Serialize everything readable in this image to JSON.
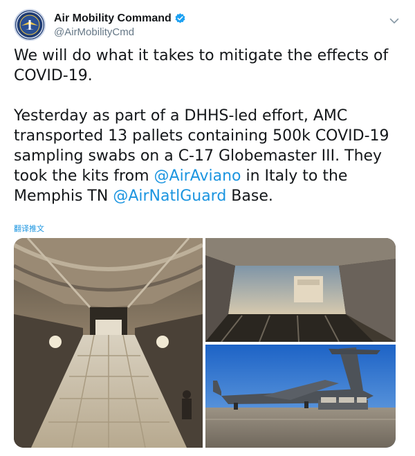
{
  "account": {
    "display_name": "Air Mobility Command",
    "handle": "@AirMobilityCmd",
    "verified": true,
    "avatar_icon": "amc-seal-icon"
  },
  "tweet": {
    "para1": "We will do what it takes to mitigate the effects of COVID-19.",
    "para2_part1": "Yesterday as part of a DHHS-led effort, AMC transported 13 pallets containing 500k COVID-19 sampling swabs on a C-17 Globemaster III. They took the kits from ",
    "mention1": "@AirAviano",
    "para2_part2": " in Italy to the Memphis TN ",
    "mention2": "@AirNatlGuard",
    "para2_part3": " Base.",
    "translate_label": "翻译推文"
  },
  "media": {
    "count": 3
  },
  "colors": {
    "link": "#1b95e0",
    "text": "#14171a",
    "secondary": "#657786",
    "verified": "#1da1f2"
  }
}
